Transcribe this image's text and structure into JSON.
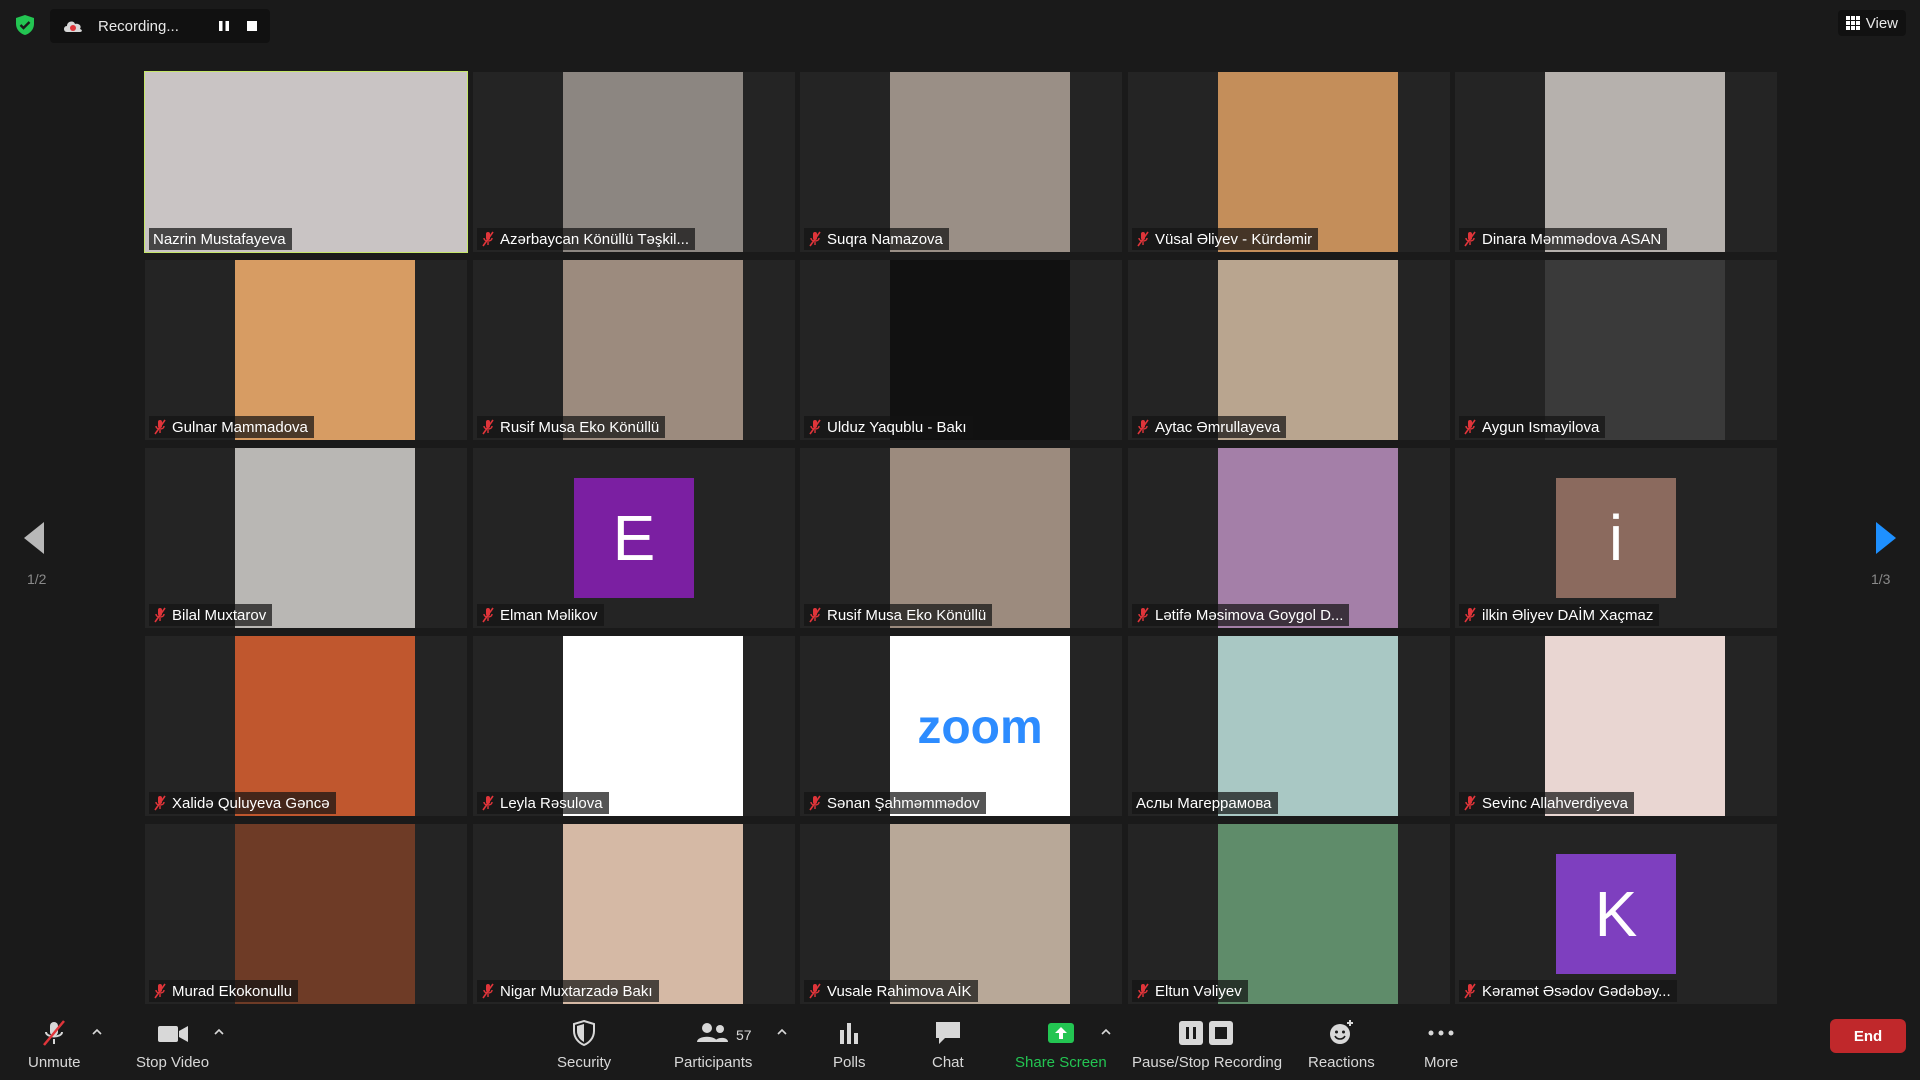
{
  "recording": {
    "label": "Recording..."
  },
  "view": {
    "label": "View"
  },
  "pages": {
    "left": "1/2",
    "right": "1/3"
  },
  "colors": {
    "accent": "#1e90ff",
    "active_border": "#c5e66a",
    "end": "#c0282b",
    "share": "#23c552"
  },
  "participants": [
    {
      "name": "Nazrin Mustafayeva",
      "muted": false,
      "active": true,
      "bg": "#c9c4c4"
    },
    {
      "name": "Azərbaycan Könüllü Təşkil...",
      "muted": true,
      "bg": "#8c8681"
    },
    {
      "name": "Suqra Namazova",
      "muted": true,
      "bg": "#9a8f86"
    },
    {
      "name": "Vüsal Əliyev - Kürdəmir",
      "muted": true,
      "bg": "#c48e5a"
    },
    {
      "name": "Dinara Məmmədova ASAN",
      "muted": true,
      "bg": "#b6b1ad"
    },
    {
      "name": "Gulnar Mammadova",
      "muted": true,
      "bg": "#d79c63"
    },
    {
      "name": "Rusif Musa Eko Könüllü",
      "muted": true,
      "bg": "#9c8b7e"
    },
    {
      "name": "Ulduz Yaqublu - Bakı",
      "muted": true,
      "bg": "#111111"
    },
    {
      "name": "Aytac Əmrullayeva",
      "muted": true,
      "bg": "#b9a58f"
    },
    {
      "name": "Aygun Ismayilova",
      "muted": true,
      "bg": "#3a3a3a"
    },
    {
      "name": "Bilal Muxtarov",
      "muted": true,
      "bg": "#b9b7b4"
    },
    {
      "name": "Elman Məlikov",
      "muted": true,
      "avatar": "E",
      "avatar_color": "#7b1fa2"
    },
    {
      "name": "Rusif Musa Eko Könüllü",
      "muted": true,
      "bg": "#9c8b7e"
    },
    {
      "name": "Lətifə Məsimova Goygol D...",
      "muted": true,
      "bg": "#a47fa8"
    },
    {
      "name": "ilkin Əliyev DAİM Xaçmaz",
      "muted": true,
      "avatar": "i",
      "avatar_color": "#8b6a5e"
    },
    {
      "name": "Xalidə Quluyeva Gəncə",
      "muted": true,
      "bg": "#c0572e"
    },
    {
      "name": "Leyla Rəsulova",
      "muted": true,
      "bg": "#ffffff"
    },
    {
      "name": "Sənan Şahməmmədov",
      "muted": true,
      "bg": "#ffffff",
      "logo": "zoom"
    },
    {
      "name": "Aслы Магеррамова",
      "muted": false,
      "bg": "#a9c8c4"
    },
    {
      "name": "Sevinc Allahverdiyeva",
      "muted": true,
      "bg": "#e9d6d2"
    },
    {
      "name": "Murad Ekokonullu",
      "muted": true,
      "bg": "#6e3b26"
    },
    {
      "name": "Nigar Muxtarzadə Bakı",
      "muted": true,
      "bg": "#d5b9a5"
    },
    {
      "name": "Vusale Rahimova AİK",
      "muted": true,
      "bg": "#b8a898"
    },
    {
      "name": "Eltun Vəliyev",
      "muted": true,
      "bg": "#5f8c6a"
    },
    {
      "name": "Kəramət Əsədov Gədəbəy...",
      "muted": true,
      "avatar": "K",
      "avatar_color": "#7e3fbf"
    }
  ],
  "toolbar": {
    "unmute": "Unmute",
    "stop_video": "Stop Video",
    "security": "Security",
    "participants": "Participants",
    "participants_count": "57",
    "polls": "Polls",
    "chat": "Chat",
    "share_screen": "Share Screen",
    "pause_stop_recording": "Pause/Stop Recording",
    "reactions": "Reactions",
    "more": "More",
    "end": "End"
  },
  "zoom_logo_text": "zoom"
}
